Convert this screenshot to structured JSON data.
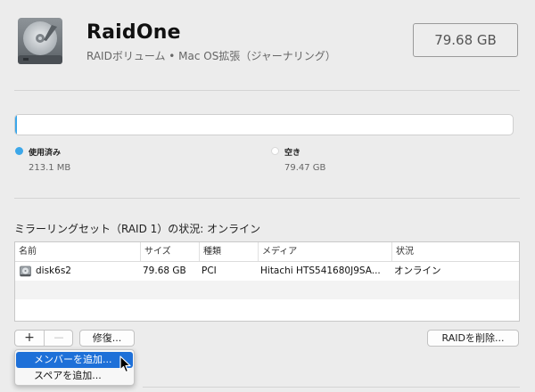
{
  "volume": {
    "name": "RaidOne",
    "subtitle": "RAIDボリューム • Mac OS拡張（ジャーナリング）",
    "size": "79.68 GB",
    "icon": "hard-drive-icon"
  },
  "usage": {
    "used_fraction": 0.003,
    "used_color": "#3ca7e9",
    "free_color": "#ffffff",
    "used_label": "使用済み",
    "used_value": "213.1 MB",
    "free_label": "空き",
    "free_value": "79.47 GB"
  },
  "raid": {
    "status_text": "ミラーリングセット（RAID 1）の状況: オンライン"
  },
  "table": {
    "columns": [
      "名前",
      "サイズ",
      "種類",
      "メディア",
      "状況"
    ],
    "rows": [
      {
        "name": "disk6s2",
        "size": "79.68 GB",
        "type": "PCI",
        "media": "Hitachi HTS541680J9SA...",
        "status": "オンライン",
        "icon": "disk-icon"
      }
    ]
  },
  "buttons": {
    "add": "+",
    "remove": "—",
    "repair": "修復...",
    "delete_raid": "RAIDを削除..."
  },
  "menu": {
    "items": [
      "メンバーを追加...",
      "スペアを追加..."
    ],
    "highlighted_index": 0,
    "highlight_color": "#1e70d8"
  }
}
